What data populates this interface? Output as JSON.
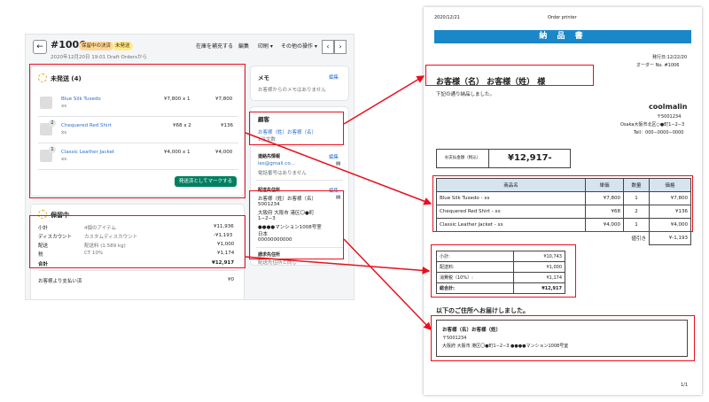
{
  "admin": {
    "order_number": "#1006",
    "badges": [
      "保留中の決済",
      "未発送"
    ],
    "subtitle": "2020年12月20日 19:01 Draft Ordersから",
    "top_actions": [
      "在庫を補充する",
      "編集",
      "印刷 ▾",
      "その他の操作 ▾"
    ],
    "unfulfilled": {
      "title": "未発送 (4)",
      "items": [
        {
          "name": "Blue Silk Tuxedo",
          "variant": "xs",
          "price": "¥7,800 x 1",
          "total": "¥7,800",
          "qty": ""
        },
        {
          "name": "Chequered Red Shirt",
          "variant": "xs",
          "price": "¥68 x 2",
          "total": "¥136",
          "qty": "2"
        },
        {
          "name": "Classic Leather Jacket",
          "variant": "xs",
          "price": "¥4,000 x 1",
          "total": "¥4,000",
          "qty": "1"
        }
      ],
      "button": "発送済としてマークする"
    },
    "pending": {
      "title": "保留中",
      "rows": [
        {
          "label": "小計",
          "desc": "4個のアイテム",
          "value": "¥11,936"
        },
        {
          "label": "ディスカウント",
          "desc": "カスタムディスカウント",
          "value": "-¥1,193"
        },
        {
          "label": "配送",
          "desc": "配送料 (1.589 kg)",
          "value": "¥1,000"
        },
        {
          "label": "税",
          "desc": "CT 10%",
          "value": "¥1,174"
        },
        {
          "label": "合計",
          "desc": "",
          "value": "¥12,917"
        }
      ],
      "paid_label": "お客様より支払い済",
      "paid_value": "¥0"
    },
    "memo": {
      "title": "メモ",
      "edit": "編集",
      "text": "お客様からのメモはありません"
    },
    "customer": {
      "title": "顧客",
      "name": "お客様（姓）お客様（名）",
      "orders": "1注文数"
    },
    "contact": {
      "title": "連絡先情報",
      "edit": "編集",
      "email": "les@gmail.co...",
      "phone": "電話番号はありません"
    },
    "shipping": {
      "title": "配送先住所",
      "edit": "編集",
      "lines": [
        "お客様（姓）お客様（名）",
        "5001234",
        "大阪府 大阪市 港区〇●町",
        "1−2−3",
        "●●●●マンション1008号室",
        "日本",
        "00000000000"
      ]
    },
    "billing": {
      "title": "請求先住所",
      "text": "配送先住所と同じ"
    }
  },
  "invoice": {
    "date": "2020/12/21",
    "header_center": "Order printer",
    "banner": "納 品 書",
    "issue_date": "発行日:12/22/20",
    "order_no": "オーダー No. #1006",
    "customer_heading": "お客様（名） お客様（姓） 様",
    "delivered_text": "下記の通り納品しました。",
    "shop_name": "coolmalin",
    "shop_postal": "〒5001234",
    "shop_address": "Osaka大阪市北区○●町1−2−3",
    "shop_tel": "Tell：000−0000−0000",
    "amount_label": "お支払金額（税込）",
    "amount_value": "¥12,917-",
    "table_headers": [
      "商品名",
      "単価",
      "数量",
      "価格"
    ],
    "table_rows": [
      {
        "name": "Blue Silk Tuxedo - xs",
        "unit": "¥7,800",
        "qty": "1",
        "price": "¥7,800"
      },
      {
        "name": "Chequered Red Shirt - xs",
        "unit": "¥68",
        "qty": "2",
        "price": "¥136"
      },
      {
        "name": "Classic Leather Jacket - xs",
        "unit": "¥4,000",
        "qty": "1",
        "price": "¥4,000"
      }
    ],
    "discount_label": "値引き",
    "discount_value": "¥-1,193",
    "totals": [
      {
        "label": "小計:",
        "value": "¥10,743"
      },
      {
        "label": "配送料:",
        "value": "¥1,000"
      },
      {
        "label": "消費税（10%）:",
        "value": "¥1,174"
      },
      {
        "label": "総合計:",
        "value": "¥12,917"
      }
    ],
    "ship_heading": "以下のご住所へお届けしました。",
    "ship_name": "お客様（名）お客様（姓）",
    "ship_postal": "〒5001234",
    "ship_address": "大阪府 大阪市 港区〇●町1−2−3 ●●●●マンション1008号室",
    "page_no": "1/1"
  },
  "colors": {
    "highlight": "#e8101e",
    "banner": "#1a87c9",
    "primary_button": "#008060",
    "link": "#2c6ecb"
  }
}
